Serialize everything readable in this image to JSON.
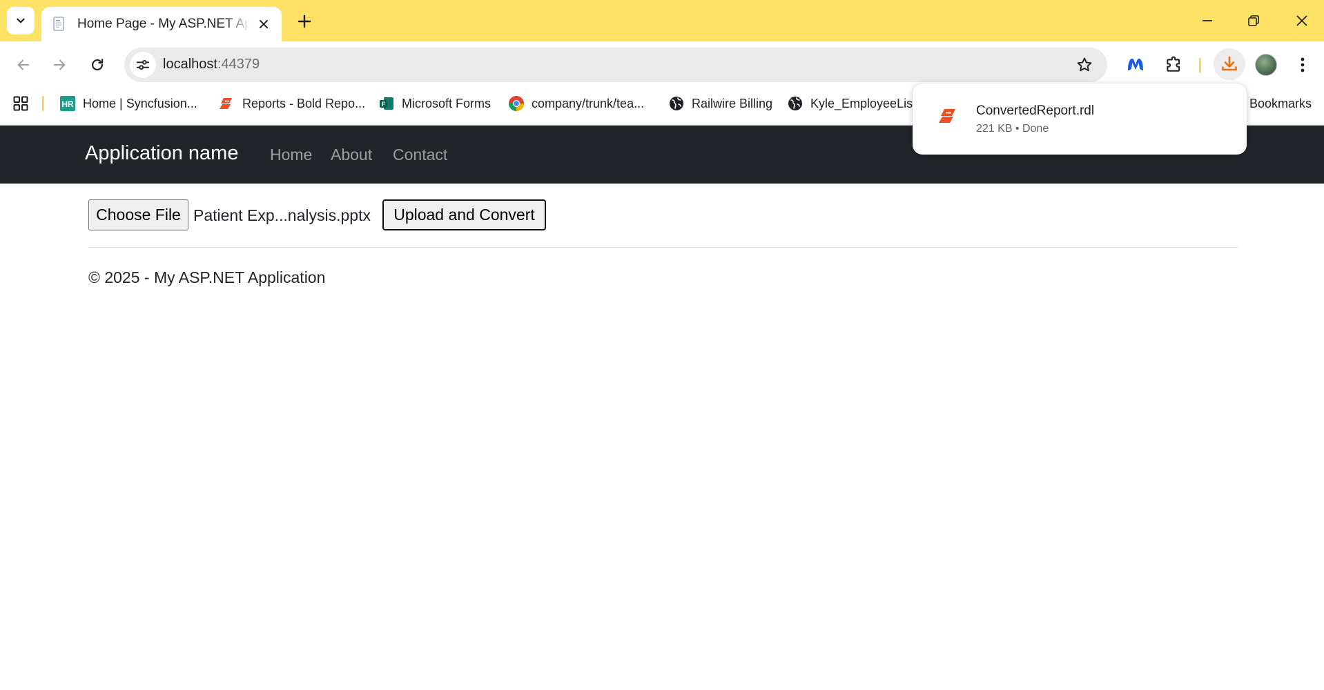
{
  "browser": {
    "tab": {
      "title": "Home Page - My ASP.NET Application"
    },
    "address": {
      "host": "localhost",
      "port": ":44379"
    },
    "bookmarks": [
      {
        "label": "Home | Syncfusion...",
        "icon": "hr-icon"
      },
      {
        "label": "Reports - Bold Repo...",
        "icon": "bold-reports-icon"
      },
      {
        "label": "Microsoft Forms",
        "icon": "microsoft-forms-icon"
      },
      {
        "label": "company/trunk/tea...",
        "icon": "chrome-icon"
      },
      {
        "label": "Railwire Billing",
        "icon": "globe-icon"
      },
      {
        "label": "Kyle_EmployeeList",
        "icon": "globe-icon"
      }
    ],
    "all_bookmarks_label": "Bookmarks",
    "download": {
      "file_name": "ConvertedReport.rdl",
      "meta": "221 KB • Done"
    },
    "colors": {
      "frame": "#fde266",
      "download_accent": "#e8710a",
      "bold_reports": "#f04f23"
    }
  },
  "site": {
    "brand": "Application name",
    "nav": [
      "Home",
      "About",
      "Contact"
    ],
    "form": {
      "choose_file_label": "Choose File",
      "selected_file": "Patient Exp...nalysis.pptx",
      "upload_label": "Upload and Convert"
    },
    "footer": "© 2025 - My ASP.NET Application",
    "colors": {
      "navbar": "#212529"
    }
  }
}
